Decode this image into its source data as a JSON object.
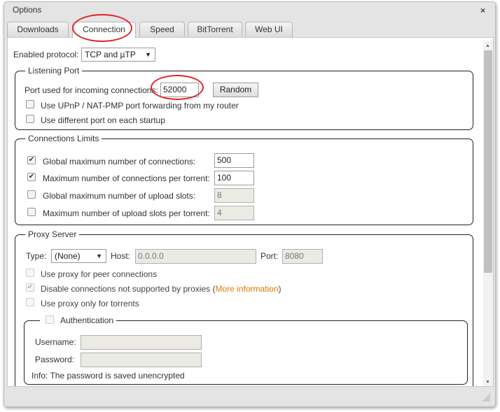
{
  "window": {
    "title": "Options",
    "close": "×"
  },
  "tabs": [
    "Downloads",
    "Connection",
    "Speed",
    "BitTorrent",
    "Web UI"
  ],
  "protocol": {
    "label": "Enabled protocol:",
    "value": "TCP and µTP"
  },
  "listening": {
    "legend": "Listening Port",
    "port_label": "Port used for incoming connections:",
    "port": "52000",
    "random": "Random",
    "upnp": "Use UPnP / NAT-PMP port forwarding from my router",
    "random_startup": "Use different port on each startup"
  },
  "limits": {
    "legend": "Connections Limits",
    "rows": [
      {
        "label": "Global maximum number of connections:",
        "value": "500",
        "checked": true
      },
      {
        "label": "Maximum number of connections per torrent:",
        "value": "100",
        "checked": true
      },
      {
        "label": "Global maximum number of upload slots:",
        "value": "8",
        "checked": false
      },
      {
        "label": "Maximum number of upload slots per torrent:",
        "value": "4",
        "checked": false
      }
    ]
  },
  "proxy": {
    "legend": "Proxy Server",
    "type_label": "Type:",
    "type": "(None)",
    "host_label": "Host:",
    "host": "0.0.0.0",
    "port_label": "Port:",
    "port": "8080",
    "peer": "Use proxy for peer connections",
    "disable": "Disable connections not supported by proxies (",
    "more": "More information",
    "close_paren": ")",
    "only_torrents": "Use proxy only for torrents"
  },
  "auth": {
    "legend": "Authentication",
    "username_label": "Username:",
    "password_label": "Password:",
    "info": "Info: The password is saved unencrypted"
  },
  "colors": {
    "link": "#e07800",
    "highlight": "#e0262a"
  }
}
